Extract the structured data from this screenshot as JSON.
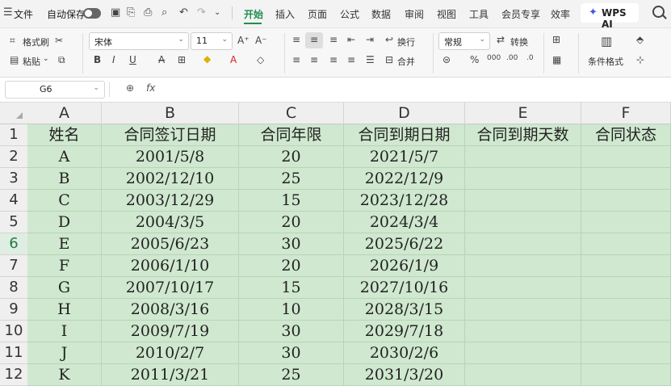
{
  "menubar": {
    "file_label": "文件",
    "autosave_label": "自动保存",
    "tabs": [
      "开始",
      "插入",
      "页面",
      "公式",
      "数据",
      "审阅",
      "视图",
      "工具",
      "会员专享",
      "效率"
    ],
    "ai_label": "WPS AI"
  },
  "ribbon": {
    "format_painter": "格式刷",
    "paste": "粘贴",
    "font_name": "宋体",
    "font_size": "11",
    "wrap": "换行",
    "merge": "合并",
    "number_format": "常规",
    "convert": "转换",
    "conditional_format": "条件格式"
  },
  "formula_bar": {
    "cell_ref": "G6",
    "fx": "fx",
    "formula": ""
  },
  "sheet": {
    "columns": [
      "A",
      "B",
      "C",
      "D",
      "E",
      "F"
    ],
    "rows": [
      "1",
      "2",
      "3",
      "4",
      "5",
      "6",
      "7",
      "8",
      "9",
      "10",
      "11",
      "12"
    ],
    "selected_row": "6",
    "header": [
      "姓名",
      "合同签订日期",
      "合同年限",
      "合同到期日期",
      "合同到期天数",
      "合同状态"
    ],
    "data": [
      [
        "A",
        "2001/5/8",
        "20",
        "2021/5/7",
        "",
        ""
      ],
      [
        "B",
        "2002/12/10",
        "25",
        "2022/12/9",
        "",
        ""
      ],
      [
        "C",
        "2003/12/29",
        "15",
        "2023/12/28",
        "",
        ""
      ],
      [
        "D",
        "2004/3/5",
        "20",
        "2024/3/4",
        "",
        ""
      ],
      [
        "E",
        "2005/6/23",
        "30",
        "2025/6/22",
        "",
        ""
      ],
      [
        "F",
        "2006/1/10",
        "20",
        "2026/1/9",
        "",
        ""
      ],
      [
        "G",
        "2007/10/17",
        "15",
        "2027/10/16",
        "",
        ""
      ],
      [
        "H",
        "2008/3/16",
        "10",
        "2028/3/15",
        "",
        ""
      ],
      [
        "I",
        "2009/7/19",
        "30",
        "2029/7/18",
        "",
        ""
      ],
      [
        "J",
        "2010/2/7",
        "30",
        "2030/2/6",
        "",
        ""
      ],
      [
        "K",
        "2011/3/21",
        "25",
        "2031/3/20",
        "",
        ""
      ]
    ]
  },
  "colors": {
    "accent": "#1f8f4e",
    "cell_fill": "#cfe8cf"
  }
}
